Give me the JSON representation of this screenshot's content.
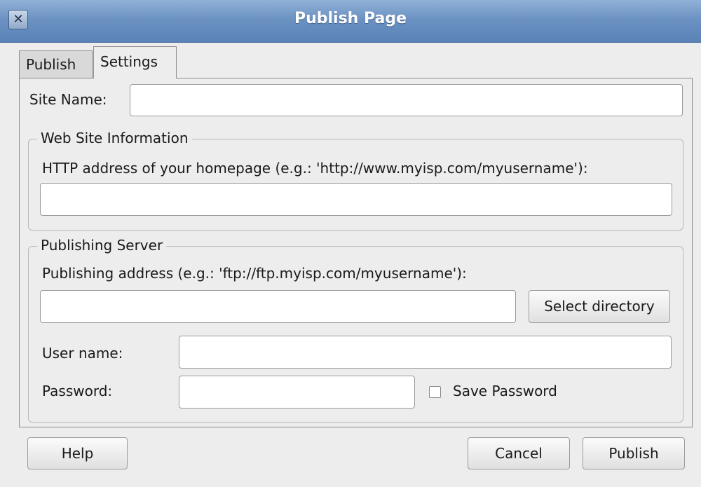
{
  "window": {
    "title": "Publish Page",
    "close_glyph": "✕"
  },
  "tabs": [
    {
      "label": "Publish",
      "active": false
    },
    {
      "label": "Settings",
      "active": true
    }
  ],
  "site_name": {
    "label": "Site Name:",
    "value": ""
  },
  "web_site_info": {
    "title": "Web Site Information",
    "http_label": "HTTP address of your homepage (e.g.: 'http://www.myisp.com/myusername'):",
    "http_value": ""
  },
  "publishing_server": {
    "title": "Publishing Server",
    "address_label": "Publishing address (e.g.: 'ftp://ftp.myisp.com/myusername'):",
    "address_value": "",
    "select_directory_label": "Select directory",
    "username_label": "User name:",
    "username_value": "",
    "password_label": "Password:",
    "password_value": "",
    "save_password_label": "Save Password",
    "save_password_checked": false
  },
  "footer": {
    "help_label": "Help",
    "cancel_label": "Cancel",
    "publish_label": "Publish"
  },
  "icons": {
    "close": "close-icon",
    "checkbox": "checkbox-icon"
  }
}
